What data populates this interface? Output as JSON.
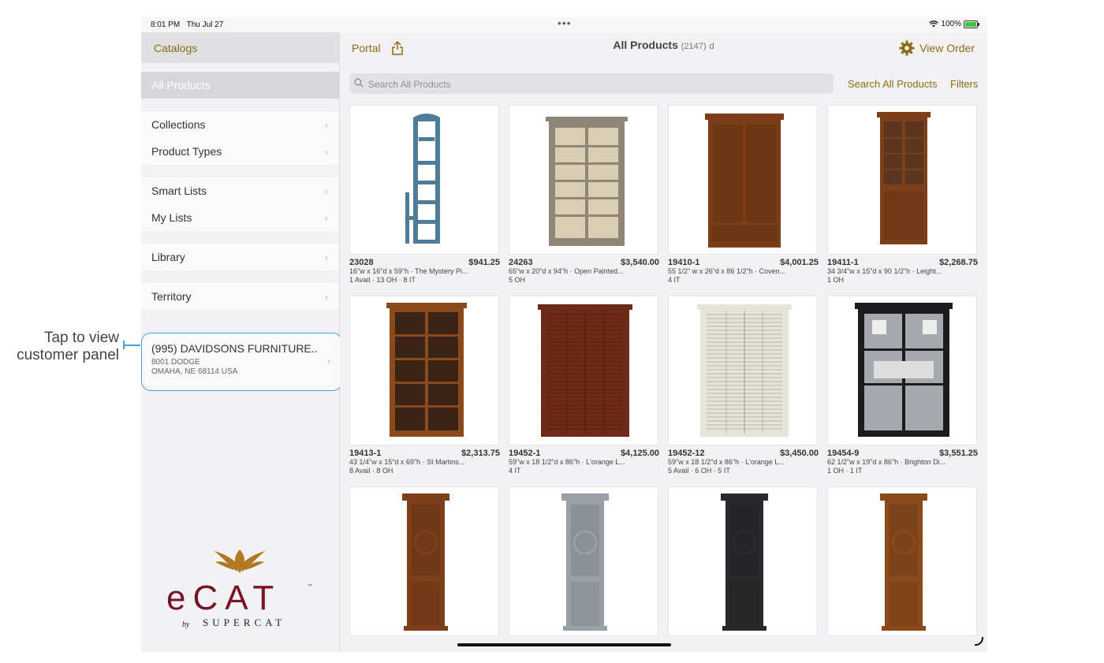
{
  "status_bar": {
    "time": "8:01 PM",
    "date": "Thu Jul 27",
    "battery": "100%"
  },
  "sidebar": {
    "header": "Catalogs",
    "items": [
      {
        "label": "All Products",
        "active": true
      },
      {
        "label": "Collections"
      },
      {
        "label": "Product Types"
      },
      {
        "label": "Smart Lists"
      },
      {
        "label": "My Lists"
      },
      {
        "label": "Library"
      },
      {
        "label": "Territory"
      }
    ],
    "customer": {
      "name": "(995) DAVIDSONS FURNITURE...",
      "address1": "8001 DODGE",
      "address2": "OMAHA, NE 68114 USA"
    },
    "logo": {
      "text": "eCAT",
      "by": "by",
      "brand": "SUPERCAT",
      "tm": "™"
    }
  },
  "topbar": {
    "portal": "Portal",
    "title": "All Products",
    "count": "(2147)",
    "count_suffix": "d",
    "view_order": "View Order"
  },
  "search": {
    "placeholder": "Search All Products",
    "search_link": "Search All Products",
    "filters": "Filters"
  },
  "products": [
    {
      "sku": "23028",
      "price": "$941.25",
      "desc": "16\"w x 16\"d x 59\"h · The Mystery Pi...",
      "stock": "1 Avail · 13 OH · 8 IT",
      "kind": "ladder",
      "color": "#4f7d98"
    },
    {
      "sku": "24263",
      "price": "$3,540.00",
      "desc": "65\"w x 20\"d x 94\"h · Open Painted...",
      "stock": "5 OH",
      "kind": "shelf",
      "color": "#8e8778"
    },
    {
      "sku": "19410-1",
      "price": "$4,001.25",
      "desc": "55 1/2\" w x 26\"d x 86 1/2\"h · Coven...",
      "stock": "4 IT",
      "kind": "armoire",
      "color": "#7a3d17"
    },
    {
      "sku": "19411-1",
      "price": "$2,268.75",
      "desc": "34 3/4\"w x 15\"d x 90 1/2\"h · Leight...",
      "stock": "1 OH",
      "kind": "tallbook",
      "color": "#7c3f1a"
    },
    {
      "sku": "19413-1",
      "price": "$2,313.75",
      "desc": "43 1/4\"w x 15\"d x 69\"h · St Martins...",
      "stock": "8 Avail · 8 OH",
      "kind": "bookcase",
      "color": "#8a4a1c"
    },
    {
      "sku": "19452-1",
      "price": "$4,125.00",
      "desc": "59\"w x 18 1/2\"d x 86\"h · L'orange L...",
      "stock": "4 IT",
      "kind": "louver",
      "color": "#6e2a16"
    },
    {
      "sku": "19452-12",
      "price": "$3,450.00",
      "desc": "59\"w x 18 1/2\"d x 86\"h · L'orange L...",
      "stock": "5 Avail · 6 OH · 5 IT",
      "kind": "louver",
      "color": "#e6e3d8"
    },
    {
      "sku": "19454-9",
      "price": "$3,551.25",
      "desc": "62 1/2\"w x 19\"d x 86\"h · Brighton Di...",
      "stock": "1 OH · 1 IT",
      "kind": "display",
      "color": "#1c1c1e"
    },
    {
      "sku": "",
      "price": "",
      "desc": "",
      "stock": "",
      "kind": "curio",
      "color": "#7c3f1a"
    },
    {
      "sku": "",
      "price": "",
      "desc": "",
      "stock": "",
      "kind": "curio",
      "color": "#9aa0a6"
    },
    {
      "sku": "",
      "price": "",
      "desc": "",
      "stock": "",
      "kind": "curio",
      "color": "#2a2a2c"
    },
    {
      "sku": "",
      "price": "",
      "desc": "",
      "stock": "",
      "kind": "curio",
      "color": "#8a4a1c"
    }
  ],
  "annotation": {
    "line1": "Tap to view",
    "line2": "customer panel"
  },
  "colors": {
    "accent": "#8a6d12",
    "highlight": "#4a9fe0",
    "logo_red": "#7a1226",
    "logo_gold": "#b07a25"
  }
}
